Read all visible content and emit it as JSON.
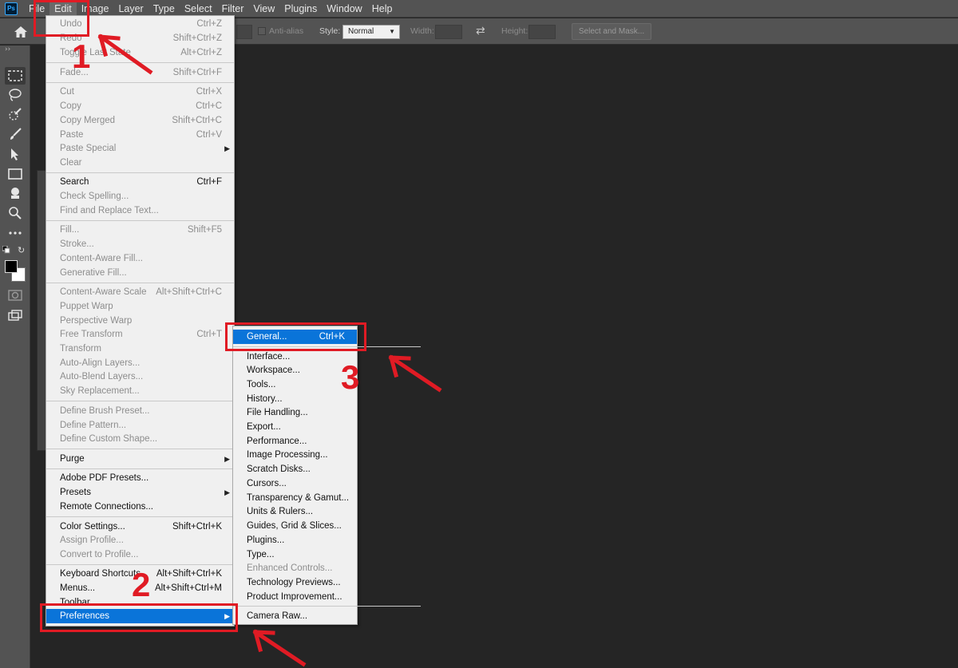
{
  "app": {
    "logo_text": "Ps"
  },
  "menubar": {
    "items": [
      "File",
      "Edit",
      "Image",
      "Layer",
      "Type",
      "Select",
      "Filter",
      "View",
      "Plugins",
      "Window",
      "Help"
    ],
    "active": "Edit"
  },
  "options": {
    "antialias_label": "Anti-alias",
    "style_label": "Style:",
    "style_value": "Normal",
    "width_label": "Width:",
    "height_label": "Height:",
    "select_mask_label": "Select and Mask..."
  },
  "edit_menu": {
    "items": [
      {
        "label": "Undo",
        "shortcut": "Ctrl+Z",
        "disabled": true
      },
      {
        "label": "Redo",
        "shortcut": "Shift+Ctrl+Z",
        "disabled": true
      },
      {
        "label": "Toggle Last State",
        "shortcut": "Alt+Ctrl+Z",
        "disabled": true
      },
      {
        "label": "Fade...",
        "shortcut": "Shift+Ctrl+F",
        "disabled": true
      },
      {
        "label": "Cut",
        "shortcut": "Ctrl+X",
        "disabled": true
      },
      {
        "label": "Copy",
        "shortcut": "Ctrl+C",
        "disabled": true
      },
      {
        "label": "Copy Merged",
        "shortcut": "Shift+Ctrl+C",
        "disabled": true
      },
      {
        "label": "Paste",
        "shortcut": "Ctrl+V",
        "disabled": true
      },
      {
        "label": "Paste Special",
        "shortcut": "",
        "disabled": true
      },
      {
        "label": "Clear",
        "shortcut": "",
        "disabled": true
      },
      {
        "label": "Search",
        "shortcut": "Ctrl+F",
        "disabled": false
      },
      {
        "label": "Check Spelling...",
        "shortcut": "",
        "disabled": true
      },
      {
        "label": "Find and Replace Text...",
        "shortcut": "",
        "disabled": true
      },
      {
        "label": "Fill...",
        "shortcut": "Shift+F5",
        "disabled": true
      },
      {
        "label": "Stroke...",
        "shortcut": "",
        "disabled": true
      },
      {
        "label": "Content-Aware Fill...",
        "shortcut": "",
        "disabled": true
      },
      {
        "label": "Generative Fill...",
        "shortcut": "",
        "disabled": true
      },
      {
        "label": "Content-Aware Scale",
        "shortcut": "Alt+Shift+Ctrl+C",
        "disabled": true
      },
      {
        "label": "Puppet Warp",
        "shortcut": "",
        "disabled": true
      },
      {
        "label": "Perspective Warp",
        "shortcut": "",
        "disabled": true
      },
      {
        "label": "Free Transform",
        "shortcut": "Ctrl+T",
        "disabled": true
      },
      {
        "label": "Transform",
        "shortcut": "",
        "disabled": true
      },
      {
        "label": "Auto-Align Layers...",
        "shortcut": "",
        "disabled": true
      },
      {
        "label": "Auto-Blend Layers...",
        "shortcut": "",
        "disabled": true
      },
      {
        "label": "Sky Replacement...",
        "shortcut": "",
        "disabled": true
      },
      {
        "label": "Define Brush Preset...",
        "shortcut": "",
        "disabled": true
      },
      {
        "label": "Define Pattern...",
        "shortcut": "",
        "disabled": true
      },
      {
        "label": "Define Custom Shape...",
        "shortcut": "",
        "disabled": true
      },
      {
        "label": "Purge",
        "shortcut": "",
        "disabled": false
      },
      {
        "label": "Adobe PDF Presets...",
        "shortcut": "",
        "disabled": false
      },
      {
        "label": "Presets",
        "shortcut": "",
        "disabled": false
      },
      {
        "label": "Remote Connections...",
        "shortcut": "",
        "disabled": false
      },
      {
        "label": "Color Settings...",
        "shortcut": "Shift+Ctrl+K",
        "disabled": false
      },
      {
        "label": "Assign Profile...",
        "shortcut": "",
        "disabled": true
      },
      {
        "label": "Convert to Profile...",
        "shortcut": "",
        "disabled": true
      },
      {
        "label": "Keyboard Shortcuts...",
        "shortcut": "Alt+Shift+Ctrl+K",
        "disabled": false
      },
      {
        "label": "Menus...",
        "shortcut": "Alt+Shift+Ctrl+M",
        "disabled": false
      },
      {
        "label": "Toolbar...",
        "shortcut": "",
        "disabled": false
      },
      {
        "label": "Preferences",
        "shortcut": "",
        "disabled": false
      }
    ]
  },
  "preferences_menu": {
    "items": [
      {
        "label": "General...",
        "shortcut": "Ctrl+K",
        "disabled": false
      },
      {
        "label": "Interface...",
        "shortcut": "",
        "disabled": false
      },
      {
        "label": "Workspace...",
        "shortcut": "",
        "disabled": false
      },
      {
        "label": "Tools...",
        "shortcut": "",
        "disabled": false
      },
      {
        "label": "History...",
        "shortcut": "",
        "disabled": false
      },
      {
        "label": "File Handling...",
        "shortcut": "",
        "disabled": false
      },
      {
        "label": "Export...",
        "shortcut": "",
        "disabled": false
      },
      {
        "label": "Performance...",
        "shortcut": "",
        "disabled": false
      },
      {
        "label": "Image Processing...",
        "shortcut": "",
        "disabled": false
      },
      {
        "label": "Scratch Disks...",
        "shortcut": "",
        "disabled": false
      },
      {
        "label": "Cursors...",
        "shortcut": "",
        "disabled": false
      },
      {
        "label": "Transparency & Gamut...",
        "shortcut": "",
        "disabled": false
      },
      {
        "label": "Units & Rulers...",
        "shortcut": "",
        "disabled": false
      },
      {
        "label": "Guides, Grid & Slices...",
        "shortcut": "",
        "disabled": false
      },
      {
        "label": "Plugins...",
        "shortcut": "",
        "disabled": false
      },
      {
        "label": "Type...",
        "shortcut": "",
        "disabled": false
      },
      {
        "label": "Enhanced Controls...",
        "shortcut": "",
        "disabled": true
      },
      {
        "label": "Technology Previews...",
        "shortcut": "",
        "disabled": false
      },
      {
        "label": "Product Improvement...",
        "shortcut": "",
        "disabled": false
      },
      {
        "label": "Camera Raw...",
        "shortcut": "",
        "disabled": false
      }
    ]
  },
  "annotations": {
    "step1": "1",
    "step2": "2",
    "step3": "3",
    "color": "#e01b24"
  },
  "colors": {
    "highlight": "#0a74d9",
    "menubar": "#535353",
    "canvas": "#252525"
  }
}
